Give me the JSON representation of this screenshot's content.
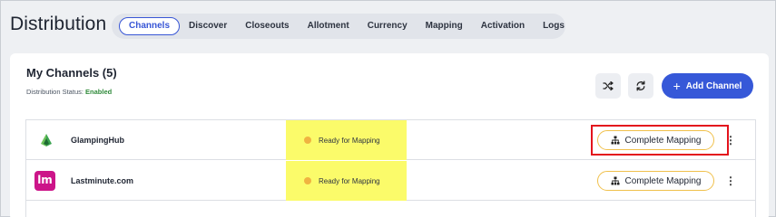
{
  "header": {
    "title": "Distribution",
    "tabs": [
      {
        "label": "Channels",
        "active": true
      },
      {
        "label": "Discover",
        "active": false
      },
      {
        "label": "Closeouts",
        "active": false
      },
      {
        "label": "Allotment",
        "active": false
      },
      {
        "label": "Currency",
        "active": false
      },
      {
        "label": "Mapping",
        "active": false
      },
      {
        "label": "Activation",
        "active": false
      },
      {
        "label": "Logs",
        "active": false
      }
    ]
  },
  "channels_card": {
    "title": "My Channels (5)",
    "status_label": "Distribution Status:",
    "status_value": "Enabled",
    "shuffle_icon": "shuffle-icon",
    "refresh_icon": "refresh-icon",
    "add_button_label": "Add Channel"
  },
  "rows": [
    {
      "name": "GlampingHub",
      "logo": "glampinghub-logo",
      "status": "Ready for Mapping",
      "action_label": "Complete Mapping"
    },
    {
      "name": "Lastminute.com",
      "logo": "lm",
      "status": "Ready for Mapping",
      "action_label": "Complete Mapping"
    }
  ],
  "colors": {
    "accent": "#3658d8",
    "status_dot": "#f0b341",
    "enabled": "#2f8a3a",
    "highlight": "#fbfb6a",
    "annotation_box": "#e3131c",
    "lastminute_brand": "#cc1589",
    "glampinghub_brand": "#3aa34f"
  }
}
